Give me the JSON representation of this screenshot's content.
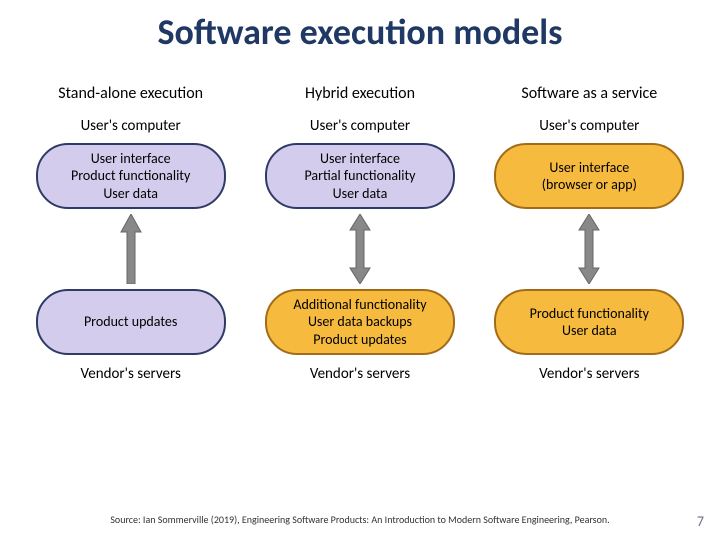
{
  "title": "Software execution models",
  "columns": [
    {
      "heading": "Stand-alone execution",
      "top_label": "User's computer",
      "box_top": [
        "User interface",
        "Product functionality",
        "User data"
      ],
      "arrow": "up",
      "box_bottom": [
        "Product updates"
      ],
      "bottom_label": "Vendor's servers"
    },
    {
      "heading": "Hybrid execution",
      "top_label": "User's computer",
      "box_top": [
        "User interface",
        "Partial functionality",
        "User data"
      ],
      "arrow": "both",
      "box_bottom": [
        "Additional functionality",
        "User data backups",
        "Product updates"
      ],
      "bottom_label": "Vendor's servers"
    },
    {
      "heading": "Software as a service",
      "top_label": "User's computer",
      "box_top": [
        "User interface",
        "(browser or app)"
      ],
      "arrow": "both",
      "box_bottom": [
        "Product functionality",
        "User data"
      ],
      "bottom_label": "Vendor's servers"
    }
  ],
  "source": "Source: Ian Sommerville (2019), Engineering Software Products: An Introduction to Modern Software Engineering, Pearson.",
  "page_number": "7"
}
